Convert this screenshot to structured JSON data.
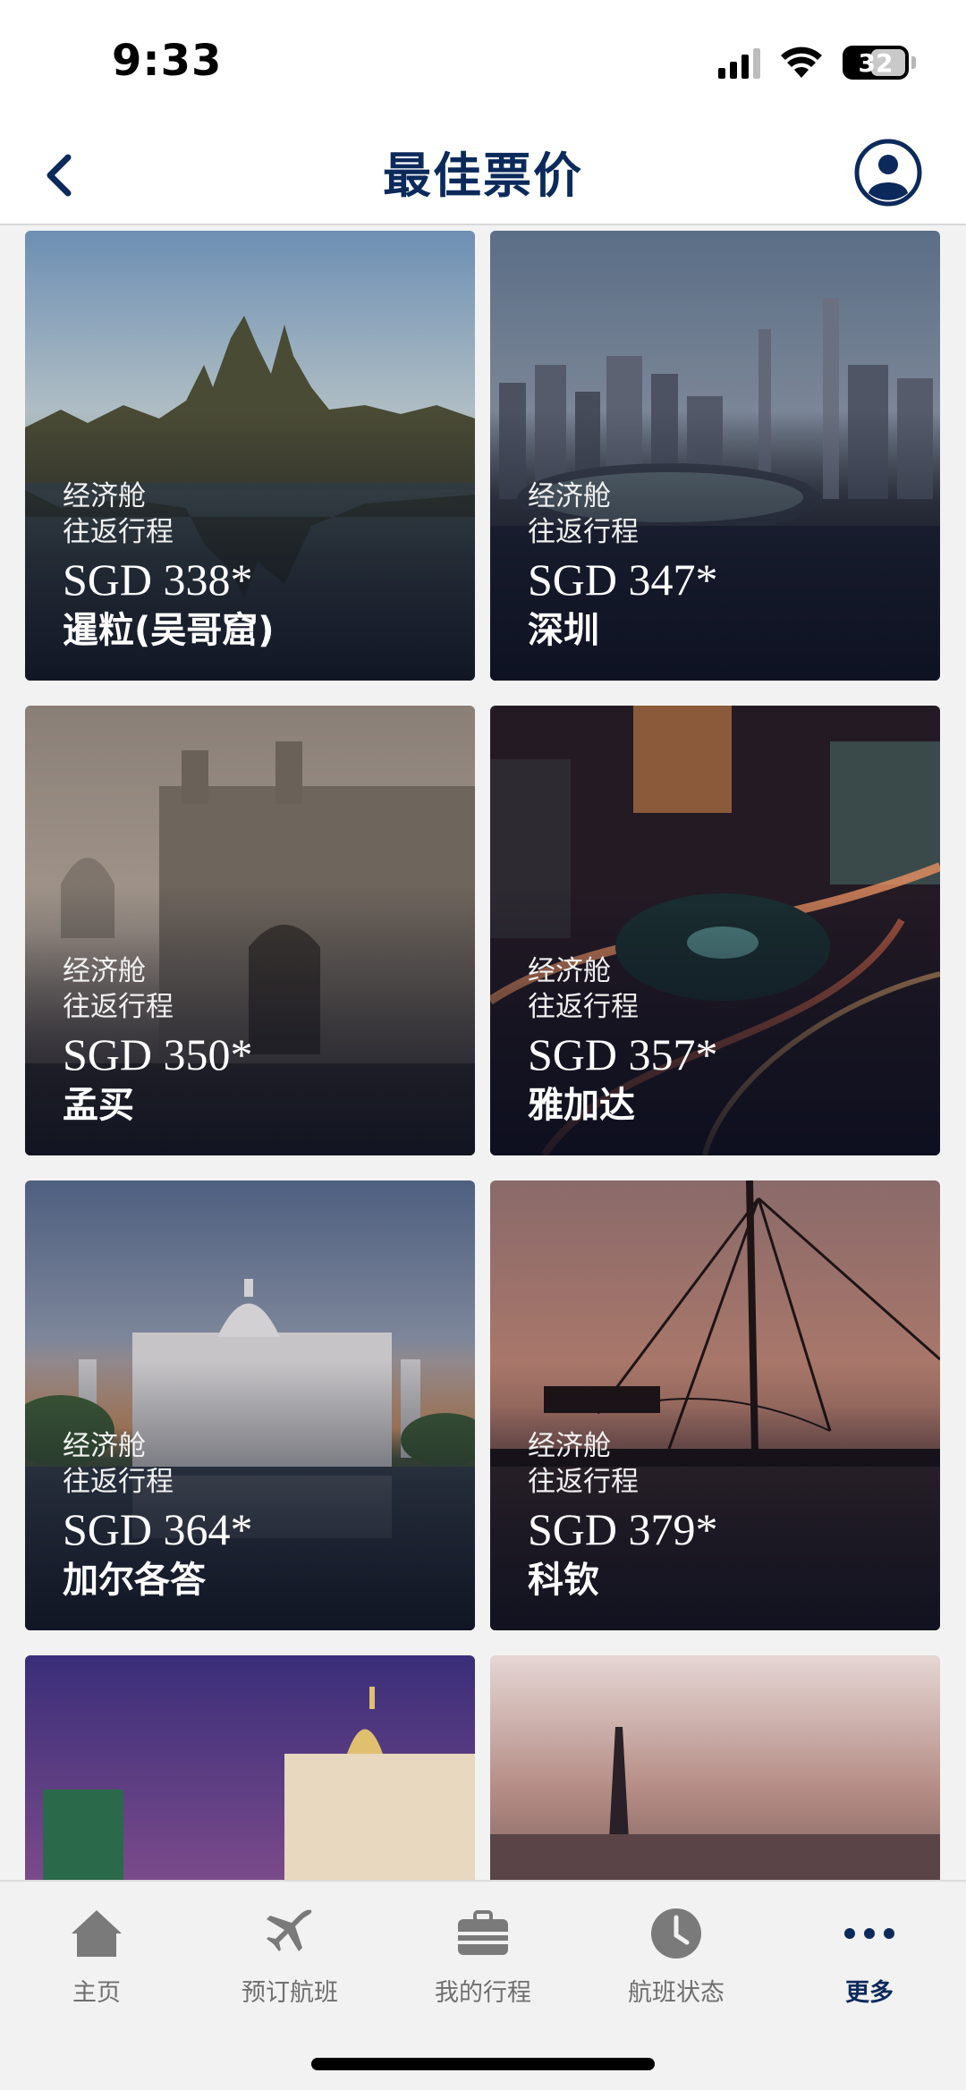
{
  "status": {
    "time": "9:33",
    "battery": "32"
  },
  "header": {
    "title": "最佳票价"
  },
  "cards": [
    {
      "cabin": "经济舱",
      "trip": "往返行程",
      "price": "SGD 338*",
      "city": "暹粒(吴哥窟)"
    },
    {
      "cabin": "经济舱",
      "trip": "往返行程",
      "price": "SGD 347*",
      "city": "深圳"
    },
    {
      "cabin": "经济舱",
      "trip": "往返行程",
      "price": "SGD 350*",
      "city": "孟买"
    },
    {
      "cabin": "经济舱",
      "trip": "往返行程",
      "price": "SGD 357*",
      "city": "雅加达"
    },
    {
      "cabin": "经济舱",
      "trip": "往返行程",
      "price": "SGD 364*",
      "city": "加尔各答"
    },
    {
      "cabin": "经济舱",
      "trip": "往返行程",
      "price": "SGD 379*",
      "city": "科钦"
    }
  ],
  "tabs": [
    {
      "label": "主页",
      "icon": "home-icon"
    },
    {
      "label": "预订航班",
      "icon": "airplane-icon"
    },
    {
      "label": "我的行程",
      "icon": "briefcase-icon"
    },
    {
      "label": "航班状态",
      "icon": "clock-icon"
    },
    {
      "label": "更多",
      "icon": "more-icon",
      "active": true
    }
  ],
  "colors": {
    "brand": "#0b2a5b",
    "inactive": "#6f6f6f"
  }
}
